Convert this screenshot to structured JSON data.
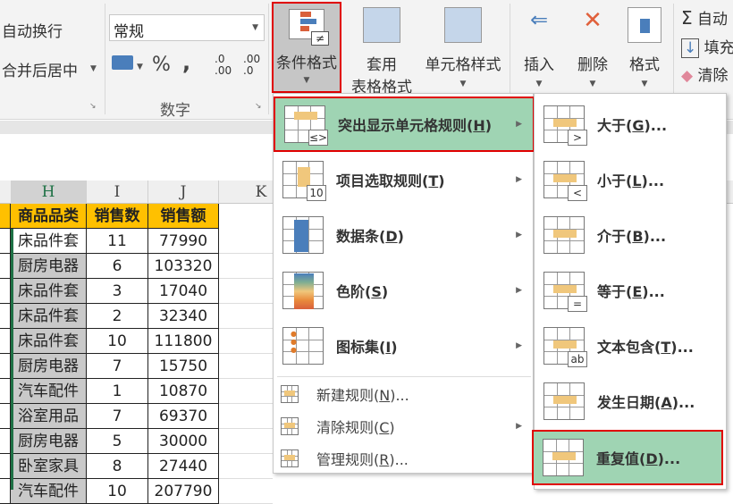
{
  "ribbon": {
    "wrap_text": "自动换行",
    "merge_center": "合并后居中",
    "number_format": "常规",
    "percent": "%",
    "comma": ",",
    "dec_inc": ".0\n.00",
    "dec_dec": ".00\n.0",
    "number_group": "数字",
    "conditional_format": "条件格式",
    "format_table_1": "套用",
    "format_table_2": "表格格式",
    "cell_styles": "单元格样式",
    "insert": "插入",
    "delete": "删除",
    "format": "格式",
    "autosum": "自动",
    "fill": "填充",
    "clear": "清除"
  },
  "sheet": {
    "columns": [
      "H",
      "I",
      "J",
      "K"
    ],
    "headers": [
      "商品品类",
      "销售数",
      "销售额"
    ],
    "rows": [
      [
        "床品件套",
        "11",
        "77990"
      ],
      [
        "厨房电器",
        "6",
        "103320"
      ],
      [
        "床品件套",
        "3",
        "17040"
      ],
      [
        "床品件套",
        "2",
        "32340"
      ],
      [
        "床品件套",
        "10",
        "111800"
      ],
      [
        "厨房电器",
        "7",
        "15750"
      ],
      [
        "汽车配件",
        "1",
        "10870"
      ],
      [
        "浴室用品",
        "7",
        "69370"
      ],
      [
        "厨房电器",
        "5",
        "30000"
      ],
      [
        "卧室家具",
        "8",
        "27440"
      ],
      [
        "汽车配件",
        "10",
        "207790"
      ]
    ]
  },
  "menu": {
    "items": [
      {
        "pre": "突出显示单元格规则(",
        "key": "H",
        "post": ")",
        "submenu": true
      },
      {
        "pre": "项目选取规则(",
        "key": "T",
        "post": ")",
        "submenu": true
      },
      {
        "pre": "数据条(",
        "key": "D",
        "post": ")",
        "submenu": true
      },
      {
        "pre": "色阶(",
        "key": "S",
        "post": ")",
        "submenu": true
      },
      {
        "pre": "图标集(",
        "key": "I",
        "post": ")",
        "submenu": true
      }
    ],
    "small_items": [
      {
        "pre": "新建规则(",
        "key": "N",
        "post": ")..."
      },
      {
        "pre": "清除规则(",
        "key": "C",
        "post": ")",
        "submenu": true
      },
      {
        "pre": "管理规则(",
        "key": "R",
        "post": ")..."
      }
    ]
  },
  "submenu": {
    "items": [
      {
        "pre": "大于(",
        "key": "G",
        "post": ")...",
        "badge": ">"
      },
      {
        "pre": "小于(",
        "key": "L",
        "post": ")...",
        "badge": "<"
      },
      {
        "pre": "介于(",
        "key": "B",
        "post": ")...",
        "badge": ""
      },
      {
        "pre": "等于(",
        "key": "E",
        "post": ")...",
        "badge": "="
      },
      {
        "pre": "文本包含(",
        "key": "T",
        "post": ")...",
        "badge": "ab"
      },
      {
        "pre": "发生日期(",
        "key": "A",
        "post": ")...",
        "badge": ""
      },
      {
        "pre": "重复值(",
        "key": "D",
        "post": ")...",
        "badge": ""
      }
    ]
  },
  "colors": {
    "highlight": "#9fd4b3",
    "header_fill": "#ffc000",
    "selection_border": "#e00000"
  }
}
